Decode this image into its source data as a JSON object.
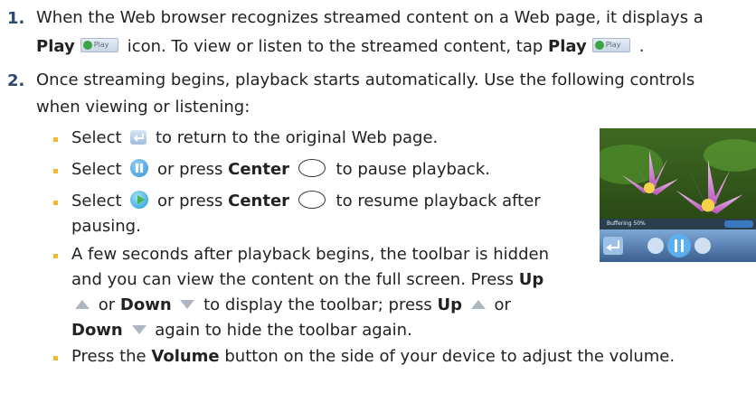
{
  "steps": [
    {
      "number": "1.",
      "line1": "When the Web browser recognizes streamed content on a Web page, it displays a",
      "line2_bold1": "Play",
      "line2_mid": "icon. To view or listen to the streamed content, tap",
      "line2_bold2": "Play",
      "line2_end": "."
    },
    {
      "number": "2.",
      "line1": "Once streaming begins, playback starts automatically. Use the following controls",
      "line2": "when viewing or listening:"
    }
  ],
  "play_icon_text": "Play",
  "bullets": {
    "b1": {
      "pre": "Select",
      "post": "to return to the original Web page."
    },
    "b2": {
      "pre": "Select",
      "mid": "or press",
      "bold": "Center",
      "post": "to pause playback."
    },
    "b3": {
      "pre": "Select",
      "mid": "or press",
      "bold": "Center",
      "post": "to resume playback after",
      "line2": "pausing."
    },
    "b4": {
      "line1": "A few seconds after playback begins, the toolbar is hidden",
      "line2_pre": "and you can view the content on the full screen. Press",
      "line2_bold": "Up",
      "line3_mid": "or",
      "line3_bold": "Down",
      "line3_post": "to display the toolbar; press",
      "line3_bold2": "Up",
      "line3_end": "or",
      "line4_bold": "Down",
      "line4_post": "again to hide the toolbar again."
    },
    "b5": {
      "pre": "Press the",
      "bold": "Volume",
      "post": "button on the side of your device to adjust the volume."
    }
  },
  "screenshot": {
    "status_text": "Buffering 50%"
  },
  "colors": {
    "step_number": "#2c4a6e",
    "bullet": "#f2b733",
    "text": "#222222"
  },
  "icons": [
    "play-icon",
    "back-icon",
    "pause-icon",
    "play-round-icon",
    "center-button-icon",
    "up-arrow-icon",
    "down-arrow-icon"
  ]
}
